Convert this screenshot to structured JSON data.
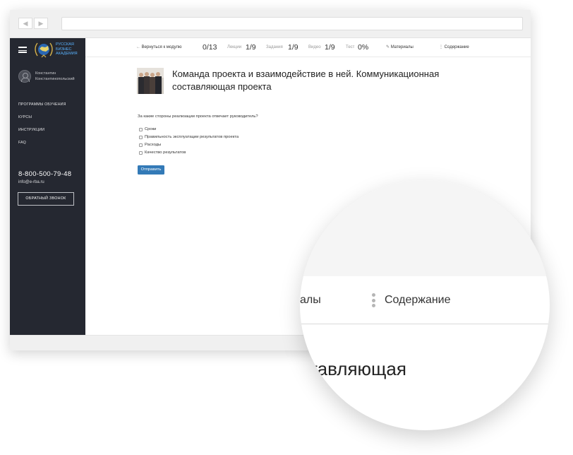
{
  "sidebar": {
    "logo_text": "РУССКАЯ БИЗНЕС АКАДЕМИЯ",
    "user_name_line1": "Константин",
    "user_name_line2": "Константинопольский",
    "menu": [
      "ПРОГРАММЫ ОБУЧЕНИЯ",
      "КУРСЫ",
      "ИНСТРУКЦИИ",
      "FAQ"
    ],
    "phone": "8-800-500-79-48",
    "email": "info@e-rba.ru",
    "callback_label": "ОБРАТНЫЙ ЗВОНОК"
  },
  "topbar": {
    "back_label": "Вернуться к модулю",
    "progress": "0/13",
    "lectures_label": "Лекции",
    "lectures_value": "1/9",
    "tasks_label": "Задания",
    "tasks_value": "1/9",
    "video_label": "Видео",
    "video_value": "1/9",
    "test_label": "Тест",
    "test_value": "0%",
    "materials_label": "Материалы",
    "contents_label": "Содержание"
  },
  "page": {
    "title": "Команда проекта и взаимодействие в ней. Коммуникационная составляющая проекта",
    "question": "За какие стороны реализации проекта отвечает руководитель?",
    "options": [
      "Сроки",
      "Правильность эксплуатации результатов проекта",
      "Расходы",
      "Качество результатов"
    ],
    "submit_label": "Отправить"
  },
  "magnifier": {
    "materials_fragment": "алы",
    "contents_label": "Содержание",
    "title_fragment": "ставляющая"
  },
  "colors": {
    "sidebar_bg": "#252831",
    "accent_blue": "#337ab7",
    "logo_blue": "#59b3ff"
  }
}
